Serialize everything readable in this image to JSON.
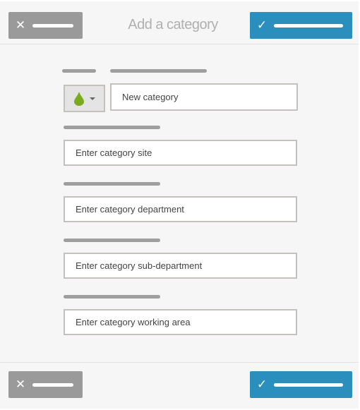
{
  "header": {
    "title": "Add a category",
    "cancel_icon": "close-icon",
    "confirm_icon": "check-icon"
  },
  "form": {
    "color_icon": "drop-icon",
    "color": "#7aab1e",
    "name_value": "New category",
    "site_placeholder": "Enter category site",
    "department_placeholder": "Enter category department",
    "subdepartment_placeholder": "Enter category sub-department",
    "working_area_placeholder": "Enter category working area"
  },
  "colors": {
    "cancel": "#9a9a9a",
    "confirm": "#2a8fbd"
  }
}
